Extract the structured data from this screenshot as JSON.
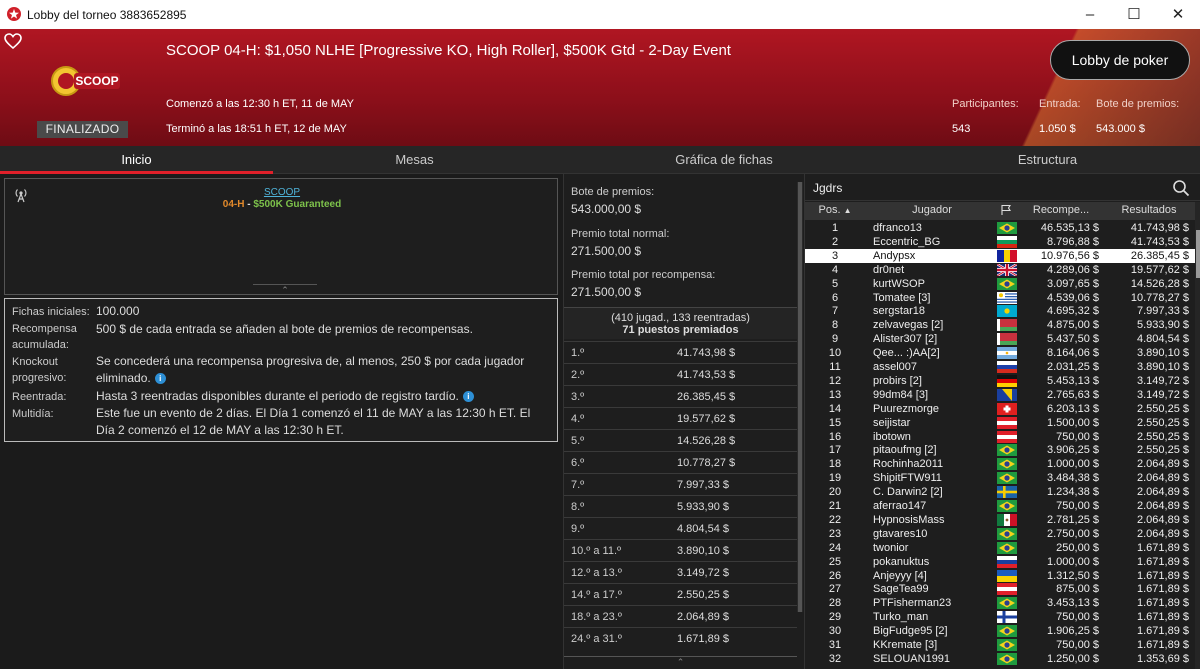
{
  "window": {
    "title": "Lobby del torneo 3883652895"
  },
  "header": {
    "event_title": "SCOOP 04-H: $1,050 NLHE [Progressive KO, High Roller], $500K Gtd - 2-Day Event",
    "started": "Comenzó a las 12:30 h ET, 11 de MAY",
    "ended": "Terminó a las 18:51 h ET, 12 de MAY",
    "status": "FINALIZADO",
    "logo_text": "SCOOP",
    "lobby_button": "Lobby de poker",
    "stats": {
      "players_label": "Participantes:",
      "players": "543",
      "buyin_label": "Entrada:",
      "buyin": "1.050 $",
      "pool_label": "Bote de premios:",
      "pool": "543.000 $"
    }
  },
  "tabs": [
    {
      "label": "Inicio",
      "active": true
    },
    {
      "label": "Mesas",
      "active": false
    },
    {
      "label": "Gráfica de fichas",
      "active": false
    },
    {
      "label": "Estructura",
      "active": false
    }
  ],
  "info": {
    "link": "SCOOP",
    "sub_a": "04-H",
    "sub_sep": " - ",
    "sub_b": "$500K Guaranteed"
  },
  "details": [
    {
      "label": "Fichas iniciales:",
      "value": "100.000"
    },
    {
      "label": "Recompensa acumulada:",
      "value": "500 $ de cada entrada se añaden al bote de premios de recompensas."
    },
    {
      "label": "Knockout progresivo:",
      "value": "Se concederá una recompensa progresiva de, al menos, 250 $ por cada jugador eliminado."
    },
    {
      "label": "Reentrada:",
      "value": "Hasta 3 reentradas disponibles durante el periodo de registro tardío."
    },
    {
      "label": "Multidía:",
      "value": "Este fue un evento de 2 días. El Día 1 comenzó el 11 de MAY a las 12:30 h ET. El Día 2 comenzó el 12 de MAY a las 12:30 h ET."
    }
  ],
  "prize": {
    "pool_label": "Bote de premios:",
    "pool": "543.000,00 $",
    "normal_label": "Premio total normal:",
    "normal": "271.500,00 $",
    "bounty_label": "Premio total por recompensa:",
    "bounty": "271.500,00 $",
    "entries": "(410 jugad., 133 reentradas)",
    "places": "71 puestos premiados"
  },
  "payouts": [
    {
      "place": "1.º",
      "amount": "41.743,98 $"
    },
    {
      "place": "2.º",
      "amount": "41.743,53 $"
    },
    {
      "place": "3.º",
      "amount": "26.385,45 $"
    },
    {
      "place": "4.º",
      "amount": "19.577,62 $"
    },
    {
      "place": "5.º",
      "amount": "14.526,28 $"
    },
    {
      "place": "6.º",
      "amount": "10.778,27 $"
    },
    {
      "place": "7.º",
      "amount": "7.997,33 $"
    },
    {
      "place": "8.º",
      "amount": "5.933,90 $"
    },
    {
      "place": "9.º",
      "amount": "4.804,54 $"
    },
    {
      "place": "10.º a 11.º",
      "amount": "3.890,10 $"
    },
    {
      "place": "12.º a 13.º",
      "amount": "3.149,72 $"
    },
    {
      "place": "14.º a 17.º",
      "amount": "2.550,25 $"
    },
    {
      "place": "18.º a 23.º",
      "amount": "2.064,89 $"
    },
    {
      "place": "24.º a 31.º",
      "amount": "1.671,89 $"
    }
  ],
  "players_search": "Jgdrs",
  "players_headers": {
    "pos": "Pos.",
    "player": "Jugador",
    "bounty": "Recompe...",
    "result": "Resultados"
  },
  "players": [
    {
      "pos": "1",
      "name": "dfranco13",
      "flag": "br",
      "bounty": "46.535,13 $",
      "result": "41.743,98 $"
    },
    {
      "pos": "2",
      "name": "Eccentric_BG",
      "flag": "bg",
      "bounty": "8.796,88 $",
      "result": "41.743,53 $"
    },
    {
      "pos": "3",
      "name": "Andypsx",
      "flag": "ad",
      "bounty": "10.976,56 $",
      "result": "26.385,45 $",
      "highlight": true
    },
    {
      "pos": "4",
      "name": "dr0net",
      "flag": "gb",
      "bounty": "4.289,06 $",
      "result": "19.577,62 $"
    },
    {
      "pos": "5",
      "name": "kurtWSOP",
      "flag": "br",
      "bounty": "3.097,65 $",
      "result": "14.526,28 $"
    },
    {
      "pos": "6",
      "name": "Tomatee [3]",
      "flag": "uy",
      "bounty": "4.539,06 $",
      "result": "10.778,27 $"
    },
    {
      "pos": "7",
      "name": "sergstar18",
      "flag": "kz",
      "bounty": "4.695,32 $",
      "result": "7.997,33 $"
    },
    {
      "pos": "8",
      "name": "zelvavegas [2]",
      "flag": "by",
      "bounty": "4.875,00 $",
      "result": "5.933,90 $"
    },
    {
      "pos": "9",
      "name": "Alister307 [2]",
      "flag": "by",
      "bounty": "5.437,50 $",
      "result": "4.804,54 $"
    },
    {
      "pos": "10",
      "name": "Qee... :)AA[2]",
      "flag": "ar",
      "bounty": "8.164,06 $",
      "result": "3.890,10 $"
    },
    {
      "pos": "11",
      "name": "assel007",
      "flag": "ru",
      "bounty": "2.031,25 $",
      "result": "3.890,10 $"
    },
    {
      "pos": "12",
      "name": "probirs [2]",
      "flag": "de",
      "bounty": "5.453,13 $",
      "result": "3.149,72 $"
    },
    {
      "pos": "13",
      "name": "99dm84 [3]",
      "flag": "ba",
      "bounty": "2.765,63 $",
      "result": "3.149,72 $"
    },
    {
      "pos": "14",
      "name": "Puurezmorge",
      "flag": "ch",
      "bounty": "6.203,13 $",
      "result": "2.550,25 $"
    },
    {
      "pos": "15",
      "name": "seijistar",
      "flag": "at",
      "bounty": "1.500,00 $",
      "result": "2.550,25 $"
    },
    {
      "pos": "16",
      "name": "ibotown",
      "flag": "at",
      "bounty": "750,00 $",
      "result": "2.550,25 $"
    },
    {
      "pos": "17",
      "name": "pitaoufmg [2]",
      "flag": "br",
      "bounty": "3.906,25 $",
      "result": "2.550,25 $"
    },
    {
      "pos": "18",
      "name": "Rochinha2011",
      "flag": "br",
      "bounty": "1.000,00 $",
      "result": "2.064,89 $"
    },
    {
      "pos": "19",
      "name": "ShipitFTW911",
      "flag": "br",
      "bounty": "3.484,38 $",
      "result": "2.064,89 $"
    },
    {
      "pos": "20",
      "name": "C. Darwin2 [2]",
      "flag": "se",
      "bounty": "1.234,38 $",
      "result": "2.064,89 $"
    },
    {
      "pos": "21",
      "name": "aferrao147",
      "flag": "br",
      "bounty": "750,00 $",
      "result": "2.064,89 $"
    },
    {
      "pos": "22",
      "name": "HypnosisMass",
      "flag": "mx",
      "bounty": "2.781,25 $",
      "result": "2.064,89 $"
    },
    {
      "pos": "23",
      "name": "gtavares10",
      "flag": "br",
      "bounty": "2.750,00 $",
      "result": "2.064,89 $"
    },
    {
      "pos": "24",
      "name": "twonior",
      "flag": "br",
      "bounty": "250,00 $",
      "result": "1.671,89 $"
    },
    {
      "pos": "25",
      "name": "pokanuktus",
      "flag": "si",
      "bounty": "1.000,00 $",
      "result": "1.671,89 $"
    },
    {
      "pos": "26",
      "name": "Anjeyyy [4]",
      "flag": "ua",
      "bounty": "1.312,50 $",
      "result": "1.671,89 $"
    },
    {
      "pos": "27",
      "name": "SageTea99",
      "flag": "at",
      "bounty": "875,00 $",
      "result": "1.671,89 $"
    },
    {
      "pos": "28",
      "name": "PTFisherman23",
      "flag": "br",
      "bounty": "3.453,13 $",
      "result": "1.671,89 $"
    },
    {
      "pos": "29",
      "name": "Turko_man",
      "flag": "fi",
      "bounty": "750,00 $",
      "result": "1.671,89 $"
    },
    {
      "pos": "30",
      "name": "BigFudge95 [2]",
      "flag": "br",
      "bounty": "1.906,25 $",
      "result": "1.671,89 $"
    },
    {
      "pos": "31",
      "name": "KKremate [3]",
      "flag": "br",
      "bounty": "750,00 $",
      "result": "1.671,89 $"
    },
    {
      "pos": "32",
      "name": "SELOUAN1991",
      "flag": "br",
      "bounty": "1.250,00 $",
      "result": "1.353,69 $"
    }
  ]
}
